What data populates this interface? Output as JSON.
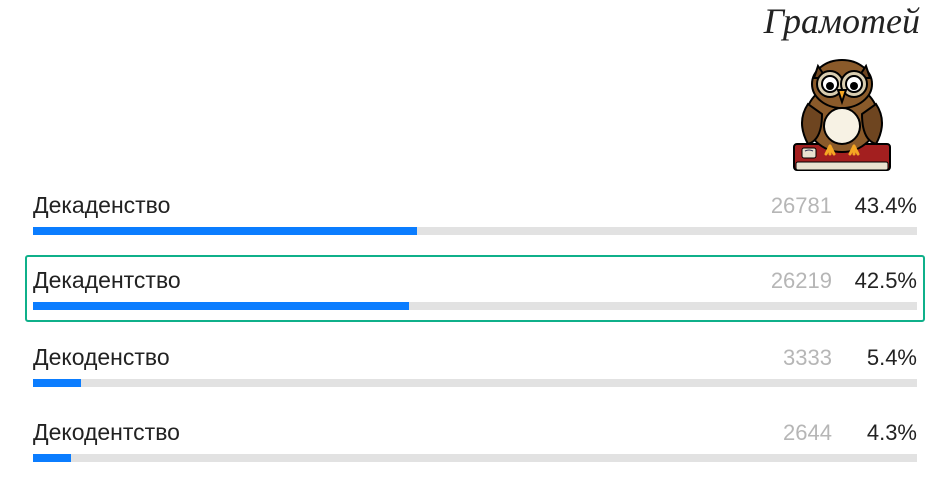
{
  "brand": {
    "title": "Грамотей"
  },
  "chart_data": {
    "type": "bar",
    "title": "",
    "xlabel": "",
    "ylabel": "",
    "ylim": [
      0,
      100
    ],
    "categories": [
      "Декаденство",
      "Декадентство",
      "Декоденство",
      "Декодентство"
    ],
    "series": [
      {
        "name": "votes",
        "values": [
          26781,
          26219,
          3333,
          2644
        ]
      },
      {
        "name": "percent",
        "values": [
          43.4,
          42.5,
          5.4,
          4.3
        ]
      }
    ]
  },
  "options": [
    {
      "label": "Декаденство",
      "count": "26781",
      "percent": "43.4%",
      "width": "43.4%",
      "highlight": false
    },
    {
      "label": "Декадентство",
      "count": "26219",
      "percent": "42.5%",
      "width": "42.5%",
      "highlight": true
    },
    {
      "label": "Декоденство",
      "count": "3333",
      "percent": "5.4%",
      "width": "5.4%",
      "highlight": false
    },
    {
      "label": "Декодентство",
      "count": "2644",
      "percent": "4.3%",
      "width": "4.3%",
      "highlight": false
    }
  ]
}
